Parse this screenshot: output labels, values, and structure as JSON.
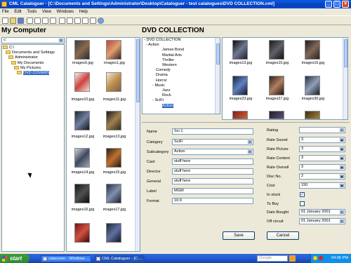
{
  "window": {
    "title": "CML Cataloguer - [C:\\Documents and Settings\\Administrator\\Desktop\\Cataloguer - test catalogues\\DVD COLLECTION.cml]",
    "controls": {
      "minimize": "_",
      "maximize": "□",
      "close": "×"
    }
  },
  "menu": [
    "File",
    "Edit",
    "Tools",
    "View",
    "Windows",
    "Help"
  ],
  "left_panel": {
    "title": "My Computer",
    "drive": "c:",
    "tree": [
      {
        "label": "C:\\",
        "indent": 0
      },
      {
        "label": "Documents and Settings",
        "indent": 1
      },
      {
        "label": "Administrator",
        "indent": 2
      },
      {
        "label": "My Documents",
        "indent": 3
      },
      {
        "label": "My Pictures",
        "indent": 4
      },
      {
        "label": "DVD COVERS",
        "indent": 5,
        "selected": true
      }
    ]
  },
  "file_thumbs": [
    "images0.jpg",
    "images1.jpg",
    "images10.jpg",
    "images11.jpg",
    "images12.jpg",
    "images13.jpg",
    "images14.jpg",
    "images15.jpg",
    "images16.jpg",
    "images17.jpg",
    "",
    ""
  ],
  "collection": {
    "title": "DVD COLLECTION",
    "tree": [
      {
        "label": "DVD COLLECTION",
        "level": 0,
        "expander": "-"
      },
      {
        "label": "Action",
        "level": 1,
        "expander": "-"
      },
      {
        "label": "James Bond",
        "level": 2
      },
      {
        "label": "Martial Arts",
        "level": 2
      },
      {
        "label": "Thriller",
        "level": 2
      },
      {
        "label": "Western",
        "level": 2
      },
      {
        "label": "Comedy",
        "level": 1
      },
      {
        "label": "Drama",
        "level": 1
      },
      {
        "label": "Horror",
        "level": 1
      },
      {
        "label": "Music",
        "level": 1,
        "expander": "-"
      },
      {
        "label": "Jazz",
        "level": 2
      },
      {
        "label": "Rock",
        "level": 2
      },
      {
        "label": "SciFi",
        "level": 1,
        "expander": "-"
      },
      {
        "label": "Action",
        "level": 2,
        "selected": true
      }
    ],
    "thumbs": [
      "images13.jpg",
      "images15.jpg",
      "images16.jpg",
      "images23.jpg",
      "images27.jpg",
      "images30.jpg",
      "",
      "",
      ""
    ]
  },
  "form": {
    "name_label": "Name",
    "name_value": "Sci 1",
    "category_label": "Category",
    "category_value": "SciFi",
    "subcategory_label": "Subcategory",
    "subcategory_value": "Action",
    "cast_label": "Cast",
    "cast_value": "stuff here",
    "director_label": "Director",
    "director_value": "stuff here",
    "general_label": "General",
    "general_value": "stuff here",
    "label_label": "Label",
    "label_value": "MGM",
    "format_label": "Format",
    "format_value": "16:9",
    "rating_label": "Rating",
    "rating_value": "",
    "rate_sound_label": "Rate Sound",
    "rate_sound_value": "3",
    "rate_picture_label": "Rate Picture",
    "rate_picture_value": "3",
    "rate_content_label": "Rate Content",
    "rate_content_value": "3",
    "rate_overall_label": "Rate Overall",
    "rate_overall_value": "3",
    "disc_no_label": "Disc No.",
    "disc_no_value": "2",
    "cost_label": "Cost",
    "cost_value": "150",
    "in_stock_label": "In stock",
    "in_stock_checked": "✓",
    "to_buy_label": "To Buy",
    "to_buy_checked": "",
    "date_bought_label": "Date Bought",
    "date_bought_value": "01   January   2001",
    "off_circuit_label": "Off circuit",
    "off_circuit_value": "01   January   2001",
    "save_label": "Save",
    "cancel_label": "Cancel"
  },
  "taskbar": {
    "start_label": "start",
    "tasks": [
      "catscreen - Windows ...",
      "CML Cataloguer - [C:..."
    ],
    "search_placeholder": "Google",
    "clock": "04:06 PM"
  }
}
